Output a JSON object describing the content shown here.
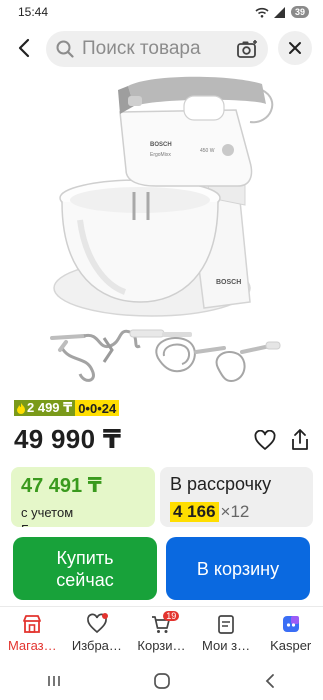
{
  "status_bar": {
    "time": "15:44",
    "battery": "39"
  },
  "search": {
    "placeholder": "Поиск товара"
  },
  "product": {
    "promo_price": "2 499 ₸",
    "promo_installment": "0•0•24",
    "price": "49 990 ₸",
    "bonus_card": {
      "amount": "47 491 ₸",
      "line1": "с учетом",
      "line2": "Б"
    },
    "installment_card": {
      "title": "В рассрочку",
      "amount": "4 166",
      "multiplier": "×12"
    }
  },
  "buttons": {
    "buy_now": "Купить сейчас",
    "add_to_cart": "В корзину"
  },
  "bottom_nav": {
    "items": [
      {
        "label": "Магаз…",
        "icon": "store-icon",
        "active": true
      },
      {
        "label": "Избра…",
        "icon": "heart-icon",
        "active": false
      },
      {
        "label": "Корзи…",
        "icon": "cart-icon",
        "active": false,
        "badge": "19"
      },
      {
        "label": "Мои з…",
        "icon": "orders-icon",
        "active": false
      },
      {
        "label": "Kasper",
        "icon": "kaspi-icon",
        "active": false
      }
    ]
  },
  "colors": {
    "buy": "#18a23a",
    "cart": "#0a69e0",
    "accent": "#e3342f",
    "installment": "#ffde00"
  }
}
